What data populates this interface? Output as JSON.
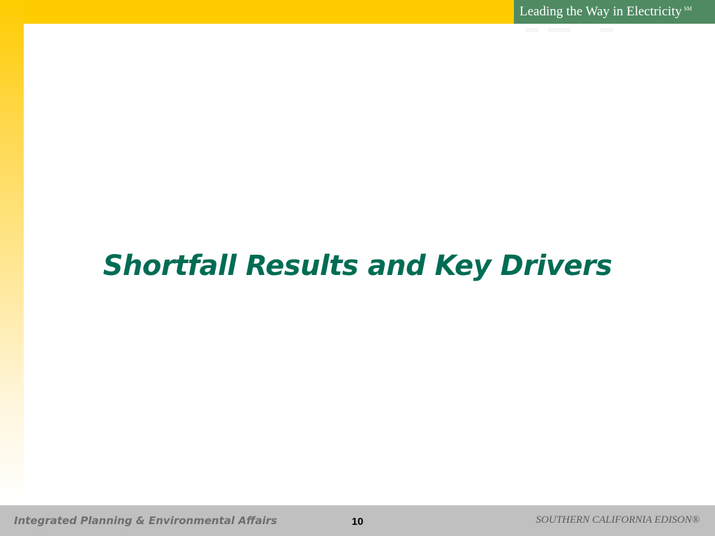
{
  "header": {
    "tagline": "Leading the Way in Electricity",
    "tagline_mark": "SM"
  },
  "slide": {
    "title": "Shortfall Results and Key Drivers"
  },
  "footer": {
    "department": "Integrated Planning & Environmental Affairs",
    "page_number": "10",
    "company": "SOUTHERN CALIFORNIA EDISON®"
  },
  "colors": {
    "accent_yellow": "#ffcc00",
    "tagline_green": "#4f8a63",
    "title_green": "#006c54",
    "footer_gray": "#c0c0c0"
  }
}
